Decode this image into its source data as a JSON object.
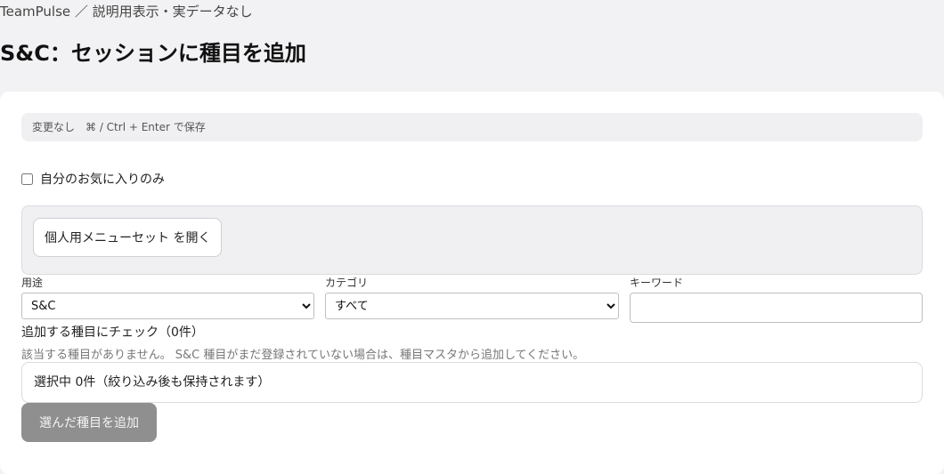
{
  "breadcrumb": "TeamPulse ／ 説明用表示・実データなし",
  "page_title": "S&C：セッションに種目を追加",
  "status_bar": "変更なし　⌘ / Ctrl + Enter で保存",
  "favorites": {
    "label": "自分のお気に入りのみ",
    "checked": false
  },
  "menu_panel": {
    "open_button_label": "個人用メニューセット を開く"
  },
  "filters": {
    "purpose": {
      "label": "用途",
      "value": "S&C"
    },
    "category": {
      "label": "カテゴリ",
      "value": "すべて"
    },
    "keyword": {
      "label": "キーワード",
      "value": ""
    }
  },
  "check_title": "追加する種目にチェック（0件）",
  "empty_message": "該当する種目がありません。 S&C 種目がまだ登録されていない場合は、種目マスタから追加してください。",
  "selected_summary": "選択中 0件（絞り込み後も保持されます）",
  "add_button_label": "選んだ種目を追加"
}
